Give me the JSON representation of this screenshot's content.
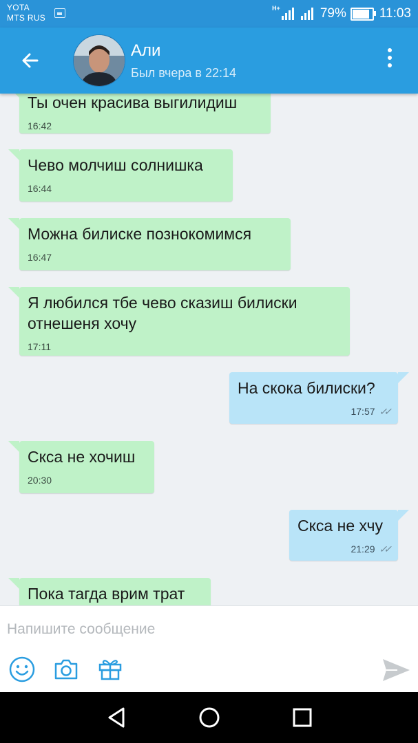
{
  "status_bar": {
    "carrier_1": "YOTA",
    "carrier_2": "MTS RUS",
    "network": "H+",
    "battery": "79%",
    "battery_level": 0.79,
    "time": "11:03"
  },
  "header": {
    "contact_name": "Али",
    "last_seen": "Был вчера в 22:14",
    "icons": [
      "back-arrow-icon",
      "avatar",
      "more-vertical-icon"
    ]
  },
  "messages": [
    {
      "direction": "in",
      "text": "Ты очен красива выгилидиш",
      "time": "16:42"
    },
    {
      "direction": "in",
      "text": "Чево молчиш солнишка",
      "time": "16:44"
    },
    {
      "direction": "in",
      "text": "Можна билиске познокомимся",
      "time": "16:47"
    },
    {
      "direction": "in",
      "text": "Я любился тбе чево сказиш билиски отнешеня хочу",
      "time": "17:11"
    },
    {
      "direction": "out",
      "text": "На скока билиски?",
      "time": "17:57",
      "status": "read"
    },
    {
      "direction": "in",
      "text": "Скса не хочиш",
      "time": "20:30"
    },
    {
      "direction": "out",
      "text": "Скса не хчу",
      "time": "21:29",
      "status": "read"
    },
    {
      "direction": "in",
      "text": "Пока тагда врим трат",
      "time": ""
    }
  ],
  "composer": {
    "placeholder": "Напишите сообщение",
    "value": "",
    "icons": [
      "emoji-icon",
      "camera-icon",
      "gift-icon",
      "send-icon"
    ]
  },
  "colors": {
    "header": "#2a9de0",
    "status_bar": "#2a93d8",
    "incoming_bubble": "#bff2c8",
    "outgoing_bubble": "#b9e4f8",
    "accent_icons": "#2a9de0"
  },
  "nav_bar": {
    "icons": [
      "back-triangle-icon",
      "home-circle-icon",
      "recents-square-icon"
    ]
  }
}
